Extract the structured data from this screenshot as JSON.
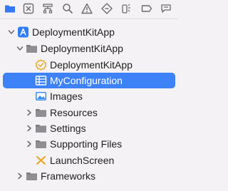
{
  "toolbar": {
    "icons": [
      "project-navigator-icon",
      "source-control-icon",
      "symbol-navigator-icon",
      "find-navigator-icon",
      "issue-navigator-icon",
      "test-navigator-icon",
      "debug-navigator-icon",
      "breakpoint-navigator-icon",
      "report-navigator-icon"
    ],
    "active_color": "#3478f6"
  },
  "tree": {
    "project": "DeploymentKitApp",
    "group": "DeploymentKitApp",
    "items": {
      "app_file": "DeploymentKitApp",
      "config": "MyConfiguration",
      "images": "Images",
      "resources": "Resources",
      "settings": "Settings",
      "supporting": "Supporting Files",
      "launch": "LaunchScreen"
    },
    "frameworks": "Frameworks"
  },
  "colors": {
    "selection": "#3d82f6",
    "folder": "#7d7d80",
    "project_icon": "#2f7cf6",
    "swift_badge": "#e9a21b",
    "launch_icon": "#e9a21b"
  }
}
